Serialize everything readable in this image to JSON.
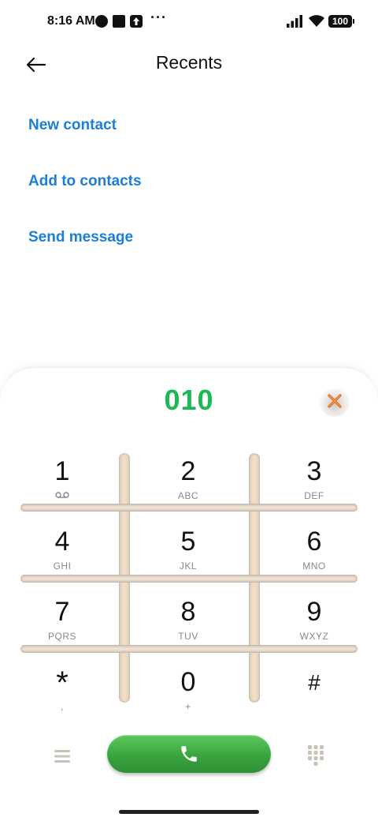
{
  "status_bar": {
    "time": "8:16 AM",
    "more": "···",
    "battery": "100"
  },
  "header": {
    "title": "Recents",
    "back_icon": "arrow-left-icon"
  },
  "actions": [
    {
      "label": "New contact"
    },
    {
      "label": "Add to contacts"
    },
    {
      "label": "Send message"
    }
  ],
  "dialer": {
    "number": "010",
    "clear_icon": "close-icon",
    "keys": [
      {
        "digit": "1",
        "letters": ""
      },
      {
        "digit": "2",
        "letters": "ABC"
      },
      {
        "digit": "3",
        "letters": "DEF"
      },
      {
        "digit": "4",
        "letters": "GHI"
      },
      {
        "digit": "5",
        "letters": "JKL"
      },
      {
        "digit": "6",
        "letters": "MNO"
      },
      {
        "digit": "7",
        "letters": "PQRS"
      },
      {
        "digit": "8",
        "letters": "TUV"
      },
      {
        "digit": "9",
        "letters": "WXYZ"
      },
      {
        "digit": "*",
        "letters": ","
      },
      {
        "digit": "0",
        "letters": "+"
      },
      {
        "digit": "#",
        "letters": ""
      }
    ],
    "call_icon": "phone-icon",
    "menu_icon": "menu-icon",
    "keypad_icon": "keypad-icon"
  },
  "colors": {
    "accent_link": "#1b7fd9",
    "dialed_number": "#1db954",
    "call_button": "#3aa43e"
  }
}
